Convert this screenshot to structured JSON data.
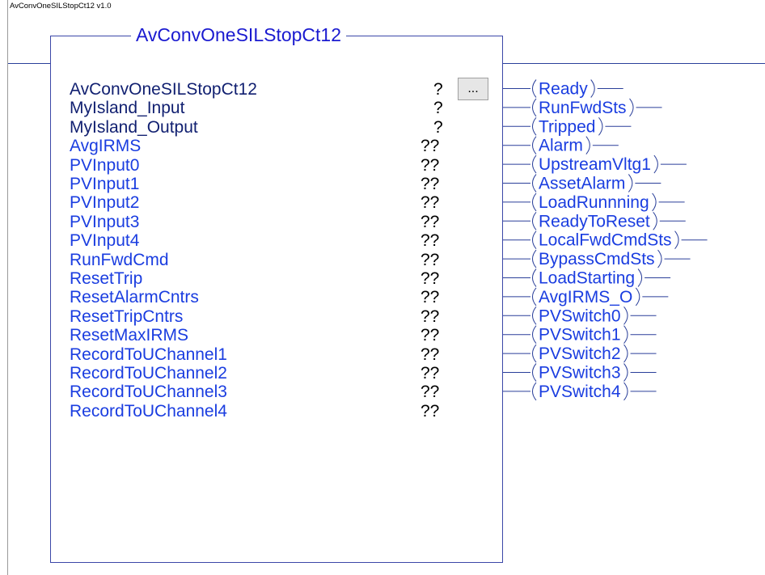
{
  "version_label": "AvConvOneSILStopCt12 v1.0",
  "block": {
    "title": "AvConvOneSILStopCt12",
    "browse_label": "...",
    "inputs": [
      {
        "name": "AvConvOneSILStopCt12",
        "value": "?",
        "required": true
      },
      {
        "name": "MyIsland_Input",
        "value": "?",
        "required": true
      },
      {
        "name": "MyIsland_Output",
        "value": "?",
        "required": true
      },
      {
        "name": "AvgIRMS",
        "value": "??",
        "required": false
      },
      {
        "name": "PVInput0",
        "value": "??",
        "required": false
      },
      {
        "name": "PVInput1",
        "value": "??",
        "required": false
      },
      {
        "name": "PVInput2",
        "value": "??",
        "required": false
      },
      {
        "name": "PVInput3",
        "value": "??",
        "required": false
      },
      {
        "name": "PVInput4",
        "value": "??",
        "required": false
      },
      {
        "name": "RunFwdCmd",
        "value": "??",
        "required": false
      },
      {
        "name": "ResetTrip",
        "value": "??",
        "required": false
      },
      {
        "name": "ResetAlarmCntrs",
        "value": "??",
        "required": false
      },
      {
        "name": "ResetTripCntrs",
        "value": "??",
        "required": false
      },
      {
        "name": "ResetMaxIRMS",
        "value": "??",
        "required": false
      },
      {
        "name": "RecordToUChannel1",
        "value": "??",
        "required": false
      },
      {
        "name": "RecordToUChannel2",
        "value": "??",
        "required": false
      },
      {
        "name": "RecordToUChannel3",
        "value": "??",
        "required": false
      },
      {
        "name": "RecordToUChannel4",
        "value": "??",
        "required": false
      }
    ],
    "outputs": [
      "Ready",
      "RunFwdSts",
      "Tripped",
      "Alarm",
      "UpstreamVltg1",
      "AssetAlarm",
      "LoadRunnning",
      "ReadyToReset",
      "LocalFwdCmdSts",
      "BypassCmdSts",
      "LoadStarting",
      "AvgIRMS_O",
      "PVSwitch0",
      "PVSwitch1",
      "PVSwitch2",
      "PVSwitch3",
      "PVSwitch4"
    ]
  }
}
